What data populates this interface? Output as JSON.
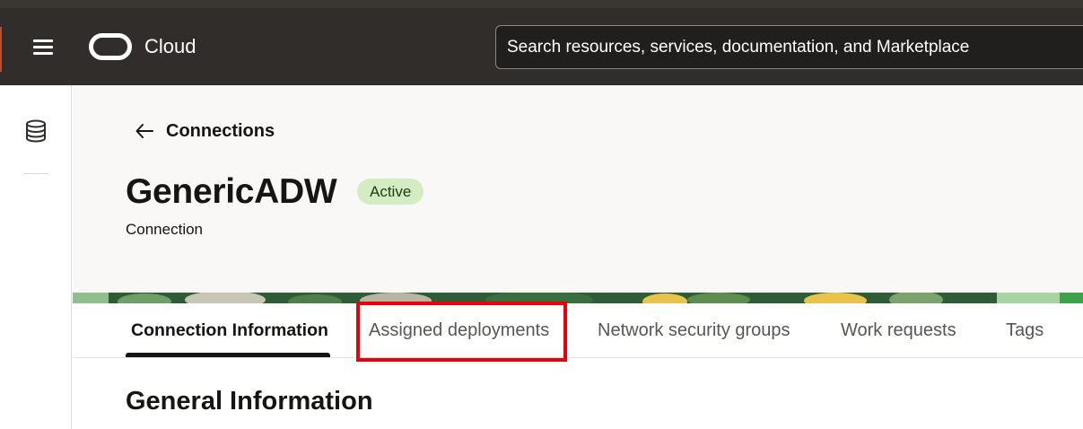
{
  "header": {
    "brand_label": "Cloud",
    "search_placeholder": "Search resources, services, documentation, and Marketplace"
  },
  "breadcrumb": {
    "back_label": "Connections"
  },
  "resource": {
    "name": "GenericADW",
    "status": "Active",
    "type": "Connection"
  },
  "tabs": [
    {
      "label": "Connection Information",
      "active": true
    },
    {
      "label": "Assigned deployments",
      "active": false,
      "highlighted": true
    },
    {
      "label": "Network security groups",
      "active": false
    },
    {
      "label": "Work requests",
      "active": false
    },
    {
      "label": "Tags",
      "active": false
    }
  ],
  "content": {
    "section_title": "General Information"
  },
  "colors": {
    "topbar": "#312d2a",
    "status_badge_bg": "#d4ecc4",
    "highlight_border": "#e8000b",
    "header_panel_bg": "#f9f8f6"
  },
  "icons": {
    "menu": "hamburger-icon",
    "logo": "oracle-logo",
    "rail": "database-icon",
    "back": "arrow-left-icon"
  }
}
